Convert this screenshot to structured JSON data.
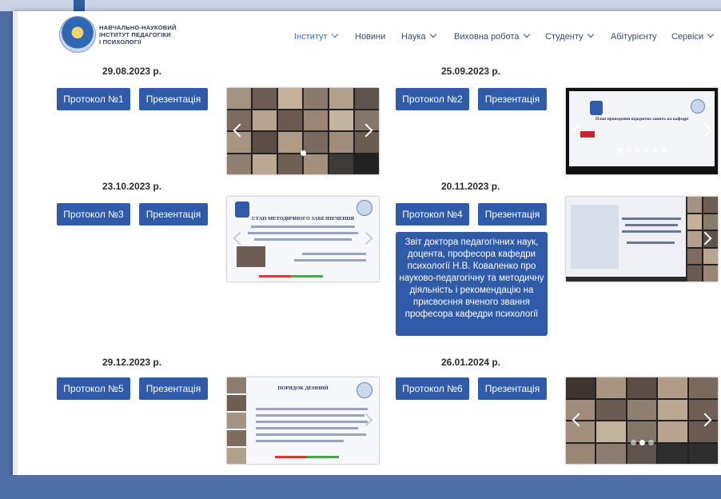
{
  "header": {
    "logo_lines": [
      "НАВЧАЛЬНО-НАУКОВИЙ",
      "ІНСТИТУТ ПЕДАГОГІКИ",
      "І ПСИХОЛОГІЇ"
    ],
    "nav": [
      {
        "label": "Інститут",
        "dropdown": true,
        "active": true
      },
      {
        "label": "Новини",
        "dropdown": false
      },
      {
        "label": "Наука",
        "dropdown": true
      },
      {
        "label": "Виховна робота",
        "dropdown": true
      },
      {
        "label": "Студенту",
        "dropdown": true
      },
      {
        "label": "Абітурієнту",
        "dropdown": false
      },
      {
        "label": "Сервіси",
        "dropdown": true
      }
    ]
  },
  "entries": [
    {
      "date": "29.08.2023 р.",
      "protocol": "Протокол №1",
      "presentation": "Презентація"
    },
    {
      "date": "25.09.2023 р.",
      "protocol": "Протокол №2",
      "presentation": "Презентація"
    },
    {
      "date": "23.10.2023 р.",
      "protocol": "Протокол №3",
      "presentation": "Презентація"
    },
    {
      "date": "20.11.2023 р.",
      "protocol": "Протокол №4",
      "presentation": "Презентація",
      "report": "Звіт доктора педагогічних наук, доцента, професора кафедри психології Н.В. Коваленко про науково-педагогічну та методичну діяльність і рекомендацію на присвоєння вченого звання професора кафедри психології"
    },
    {
      "date": "29.12.2023 р.",
      "protocol": "Протокол №5",
      "presentation": "Презентація"
    },
    {
      "date": "26.01.2024 р.",
      "protocol": "Протокол №6",
      "presentation": "Презентація"
    }
  ],
  "slides": {
    "s2": "План проведення відкритих занять на кафедрі",
    "s3": "СТАН МЕТОДИЧНОГО ЗАБЕЗПЕЧЕННЯ",
    "s5": "ПОРЯДОК ДЕННИЙ"
  },
  "colors": {
    "accent": "#2f5ba8",
    "nav_active": "#3a6fc8",
    "background": "#4d6ea6"
  }
}
